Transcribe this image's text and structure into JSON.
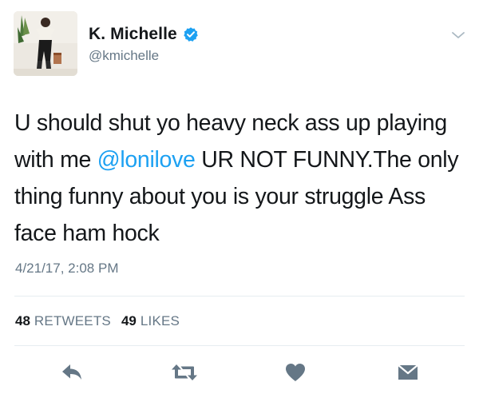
{
  "author": {
    "display_name": "K. Michelle",
    "handle": "@kmichelle",
    "verified": true,
    "avatar_icon": "profile-photo"
  },
  "tweet": {
    "text_before_mention": "U should shut yo heavy neck ass up playing with me ",
    "mention": "@lonilove",
    "text_after_mention": " UR NOT FUNNY.The only thing funny about you is your struggle Ass face ham hock",
    "timestamp": "4/21/17, 2:08 PM"
  },
  "stats": {
    "retweets_count": "48",
    "retweets_label": "RETWEETS",
    "likes_count": "49",
    "likes_label": "LIKES"
  },
  "actions": {
    "reply_icon": "reply-icon",
    "retweet_icon": "retweet-icon",
    "like_icon": "heart-icon",
    "dm_icon": "direct-message-icon"
  },
  "colors": {
    "accent": "#1da1f2",
    "text": "#14171a",
    "muted": "#657786",
    "icon": "#657786",
    "divider": "#e6ecf0",
    "verified": "#1da1f2"
  }
}
